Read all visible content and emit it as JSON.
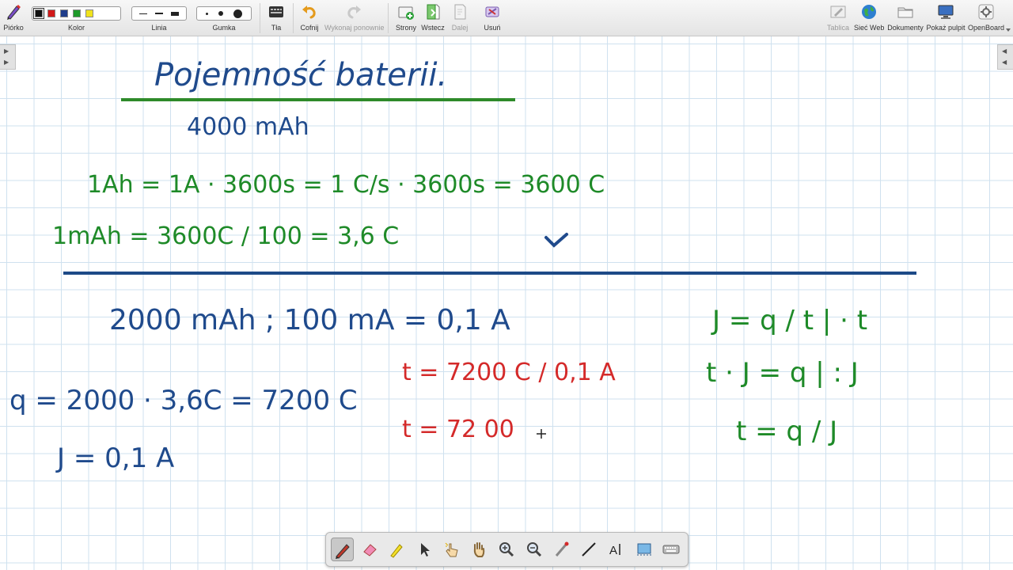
{
  "toolbar": {
    "pen": "Piórko",
    "color": "Kolor",
    "line": "Linia",
    "eraser": "Gumka",
    "background": "Tła",
    "undo": "Cofnij",
    "redo": "Wykonaj ponownie",
    "pages": "Strony",
    "back": "Wstecz",
    "next": "Dalej",
    "delete": "Usuń",
    "board": "Tablica",
    "web": "Sieć Web",
    "documents": "Dokumenty",
    "show_desktop": "Pokaż pulpit",
    "openboard": "OpenBoard",
    "colors": [
      "#111111",
      "#d21a1a",
      "#1f3d8a",
      "#1e9a2a",
      "#f0e21c"
    ]
  },
  "board": {
    "title": "Pojemność baterii.",
    "capacity": "4000 mAh",
    "eq1": "1Ah = 1A · 3600s = 1 C/s · 3600s = 3600 C",
    "eq2": "1mAh = 3600C / 100 = 3,6 C",
    "given": "2000 mAh ; 100 mA = 0,1 A",
    "q_calc": "q = 2000 · 3,6C = 7200 C",
    "current": "J = 0,1 A",
    "t_frac": "t = 7200 C / 0,1 A",
    "t_result": "t = 72 00",
    "formula1": "J = q / t | · t",
    "formula2": "t · J = q | : J",
    "formula3": "t = q / J"
  },
  "palette": {
    "tools": [
      "pen",
      "eraser",
      "marker",
      "selector",
      "interact",
      "hand",
      "zoom-in",
      "zoom-out",
      "laser",
      "line",
      "text",
      "capture",
      "keyboard"
    ]
  }
}
